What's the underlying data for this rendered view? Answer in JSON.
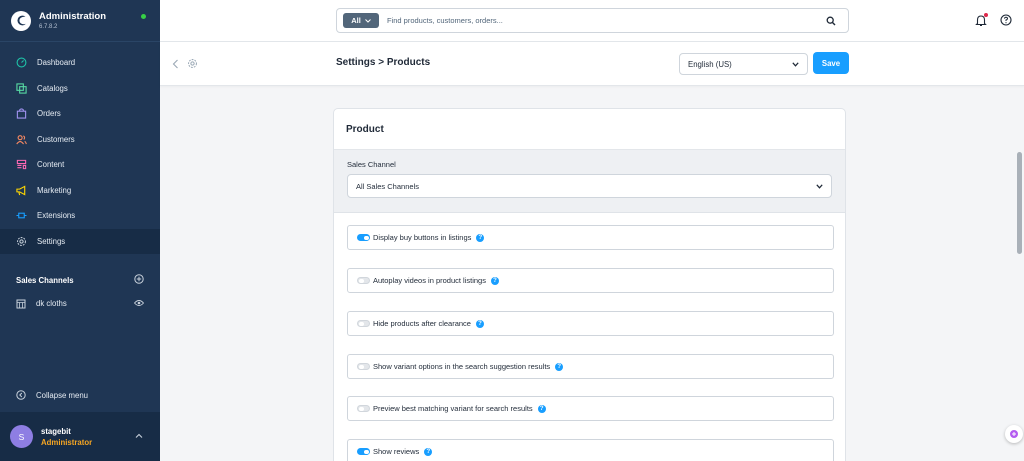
{
  "brand": {
    "title": "Administration",
    "version": "6.7.8.2"
  },
  "sidebar": {
    "items": [
      {
        "label": "Dashboard",
        "icon": "dashboard-icon",
        "color": "#1ec3a8"
      },
      {
        "label": "Catalogs",
        "icon": "catalog-icon",
        "color": "#57d9a3"
      },
      {
        "label": "Orders",
        "icon": "orders-icon",
        "color": "#a092f0"
      },
      {
        "label": "Customers",
        "icon": "customers-icon",
        "color": "#f88962"
      },
      {
        "label": "Content",
        "icon": "content-icon",
        "color": "#ff68b4"
      },
      {
        "label": "Marketing",
        "icon": "marketing-icon",
        "color": "#ffd700"
      },
      {
        "label": "Extensions",
        "icon": "extensions-icon",
        "color": "#189eff"
      },
      {
        "label": "Settings",
        "icon": "settings-icon",
        "color": "#9aa8b5"
      }
    ],
    "sales_channels_title": "Sales Channels",
    "sales_channel_item": "dk cloths",
    "collapse_label": "Collapse menu"
  },
  "user": {
    "initial": "S",
    "name": "stagebit",
    "role": "Administrator"
  },
  "search": {
    "type": "All",
    "placeholder": "Find products, customers, orders..."
  },
  "smartbar": {
    "title": "Settings > Products",
    "language": "English (US)",
    "save_label": "Save"
  },
  "card": {
    "title": "Product",
    "sales_channel_label": "Sales Channel",
    "sales_channel_value": "All Sales Channels",
    "options": [
      {
        "label": "Display buy buttons in listings",
        "enabled": true
      },
      {
        "label": "Autoplay videos in product listings",
        "enabled": false
      },
      {
        "label": "Hide products after clearance",
        "enabled": false
      },
      {
        "label": "Show variant options in the search suggestion results",
        "enabled": false
      },
      {
        "label": "Preview best matching variant for search results",
        "enabled": false
      },
      {
        "label": "Show reviews",
        "enabled": true
      }
    ]
  },
  "colors": {
    "sidebar_bg": "#1f3654",
    "accent": "#189eff",
    "role": "#f6a623"
  }
}
